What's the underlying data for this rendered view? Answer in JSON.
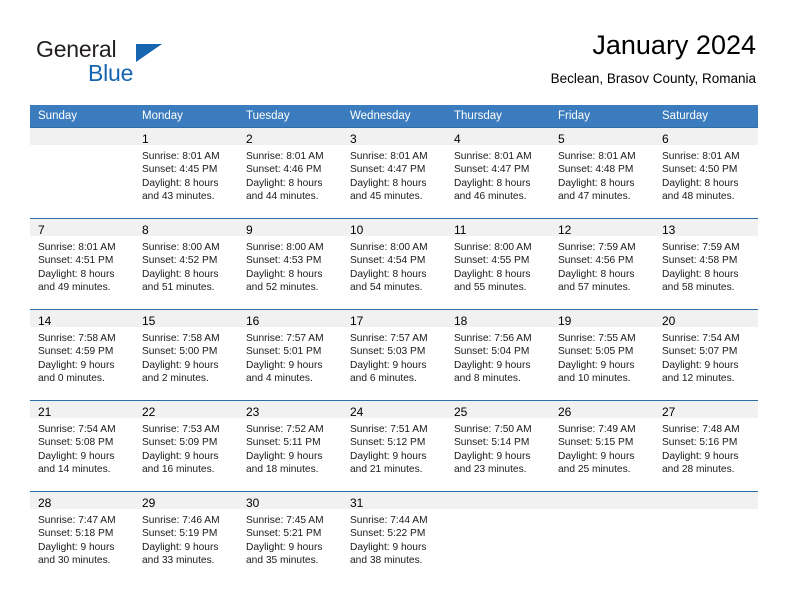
{
  "brand": {
    "name_part1": "General",
    "name_part2": "Blue",
    "accent_color": "#1565b0",
    "logo_icon": "triangle-icon"
  },
  "header": {
    "title": "January 2024",
    "subtitle": "Beclean, Brasov County, Romania"
  },
  "calendar": {
    "header_bg": "#3b7cbe",
    "weekday_headers": [
      "Sunday",
      "Monday",
      "Tuesday",
      "Wednesday",
      "Thursday",
      "Friday",
      "Saturday"
    ],
    "weeks": [
      [
        {
          "day": "",
          "lines": []
        },
        {
          "day": "1",
          "lines": [
            "Sunrise: 8:01 AM",
            "Sunset: 4:45 PM",
            "Daylight: 8 hours",
            "and 43 minutes."
          ]
        },
        {
          "day": "2",
          "lines": [
            "Sunrise: 8:01 AM",
            "Sunset: 4:46 PM",
            "Daylight: 8 hours",
            "and 44 minutes."
          ]
        },
        {
          "day": "3",
          "lines": [
            "Sunrise: 8:01 AM",
            "Sunset: 4:47 PM",
            "Daylight: 8 hours",
            "and 45 minutes."
          ]
        },
        {
          "day": "4",
          "lines": [
            "Sunrise: 8:01 AM",
            "Sunset: 4:47 PM",
            "Daylight: 8 hours",
            "and 46 minutes."
          ]
        },
        {
          "day": "5",
          "lines": [
            "Sunrise: 8:01 AM",
            "Sunset: 4:48 PM",
            "Daylight: 8 hours",
            "and 47 minutes."
          ]
        },
        {
          "day": "6",
          "lines": [
            "Sunrise: 8:01 AM",
            "Sunset: 4:50 PM",
            "Daylight: 8 hours",
            "and 48 minutes."
          ]
        }
      ],
      [
        {
          "day": "7",
          "lines": [
            "Sunrise: 8:01 AM",
            "Sunset: 4:51 PM",
            "Daylight: 8 hours",
            "and 49 minutes."
          ]
        },
        {
          "day": "8",
          "lines": [
            "Sunrise: 8:00 AM",
            "Sunset: 4:52 PM",
            "Daylight: 8 hours",
            "and 51 minutes."
          ]
        },
        {
          "day": "9",
          "lines": [
            "Sunrise: 8:00 AM",
            "Sunset: 4:53 PM",
            "Daylight: 8 hours",
            "and 52 minutes."
          ]
        },
        {
          "day": "10",
          "lines": [
            "Sunrise: 8:00 AM",
            "Sunset: 4:54 PM",
            "Daylight: 8 hours",
            "and 54 minutes."
          ]
        },
        {
          "day": "11",
          "lines": [
            "Sunrise: 8:00 AM",
            "Sunset: 4:55 PM",
            "Daylight: 8 hours",
            "and 55 minutes."
          ]
        },
        {
          "day": "12",
          "lines": [
            "Sunrise: 7:59 AM",
            "Sunset: 4:56 PM",
            "Daylight: 8 hours",
            "and 57 minutes."
          ]
        },
        {
          "day": "13",
          "lines": [
            "Sunrise: 7:59 AM",
            "Sunset: 4:58 PM",
            "Daylight: 8 hours",
            "and 58 minutes."
          ]
        }
      ],
      [
        {
          "day": "14",
          "lines": [
            "Sunrise: 7:58 AM",
            "Sunset: 4:59 PM",
            "Daylight: 9 hours",
            "and 0 minutes."
          ]
        },
        {
          "day": "15",
          "lines": [
            "Sunrise: 7:58 AM",
            "Sunset: 5:00 PM",
            "Daylight: 9 hours",
            "and 2 minutes."
          ]
        },
        {
          "day": "16",
          "lines": [
            "Sunrise: 7:57 AM",
            "Sunset: 5:01 PM",
            "Daylight: 9 hours",
            "and 4 minutes."
          ]
        },
        {
          "day": "17",
          "lines": [
            "Sunrise: 7:57 AM",
            "Sunset: 5:03 PM",
            "Daylight: 9 hours",
            "and 6 minutes."
          ]
        },
        {
          "day": "18",
          "lines": [
            "Sunrise: 7:56 AM",
            "Sunset: 5:04 PM",
            "Daylight: 9 hours",
            "and 8 minutes."
          ]
        },
        {
          "day": "19",
          "lines": [
            "Sunrise: 7:55 AM",
            "Sunset: 5:05 PM",
            "Daylight: 9 hours",
            "and 10 minutes."
          ]
        },
        {
          "day": "20",
          "lines": [
            "Sunrise: 7:54 AM",
            "Sunset: 5:07 PM",
            "Daylight: 9 hours",
            "and 12 minutes."
          ]
        }
      ],
      [
        {
          "day": "21",
          "lines": [
            "Sunrise: 7:54 AM",
            "Sunset: 5:08 PM",
            "Daylight: 9 hours",
            "and 14 minutes."
          ]
        },
        {
          "day": "22",
          "lines": [
            "Sunrise: 7:53 AM",
            "Sunset: 5:09 PM",
            "Daylight: 9 hours",
            "and 16 minutes."
          ]
        },
        {
          "day": "23",
          "lines": [
            "Sunrise: 7:52 AM",
            "Sunset: 5:11 PM",
            "Daylight: 9 hours",
            "and 18 minutes."
          ]
        },
        {
          "day": "24",
          "lines": [
            "Sunrise: 7:51 AM",
            "Sunset: 5:12 PM",
            "Daylight: 9 hours",
            "and 21 minutes."
          ]
        },
        {
          "day": "25",
          "lines": [
            "Sunrise: 7:50 AM",
            "Sunset: 5:14 PM",
            "Daylight: 9 hours",
            "and 23 minutes."
          ]
        },
        {
          "day": "26",
          "lines": [
            "Sunrise: 7:49 AM",
            "Sunset: 5:15 PM",
            "Daylight: 9 hours",
            "and 25 minutes."
          ]
        },
        {
          "day": "27",
          "lines": [
            "Sunrise: 7:48 AM",
            "Sunset: 5:16 PM",
            "Daylight: 9 hours",
            "and 28 minutes."
          ]
        }
      ],
      [
        {
          "day": "28",
          "lines": [
            "Sunrise: 7:47 AM",
            "Sunset: 5:18 PM",
            "Daylight: 9 hours",
            "and 30 minutes."
          ]
        },
        {
          "day": "29",
          "lines": [
            "Sunrise: 7:46 AM",
            "Sunset: 5:19 PM",
            "Daylight: 9 hours",
            "and 33 minutes."
          ]
        },
        {
          "day": "30",
          "lines": [
            "Sunrise: 7:45 AM",
            "Sunset: 5:21 PM",
            "Daylight: 9 hours",
            "and 35 minutes."
          ]
        },
        {
          "day": "31",
          "lines": [
            "Sunrise: 7:44 AM",
            "Sunset: 5:22 PM",
            "Daylight: 9 hours",
            "and 38 minutes."
          ]
        },
        {
          "day": "",
          "lines": []
        },
        {
          "day": "",
          "lines": []
        },
        {
          "day": "",
          "lines": []
        }
      ]
    ]
  }
}
